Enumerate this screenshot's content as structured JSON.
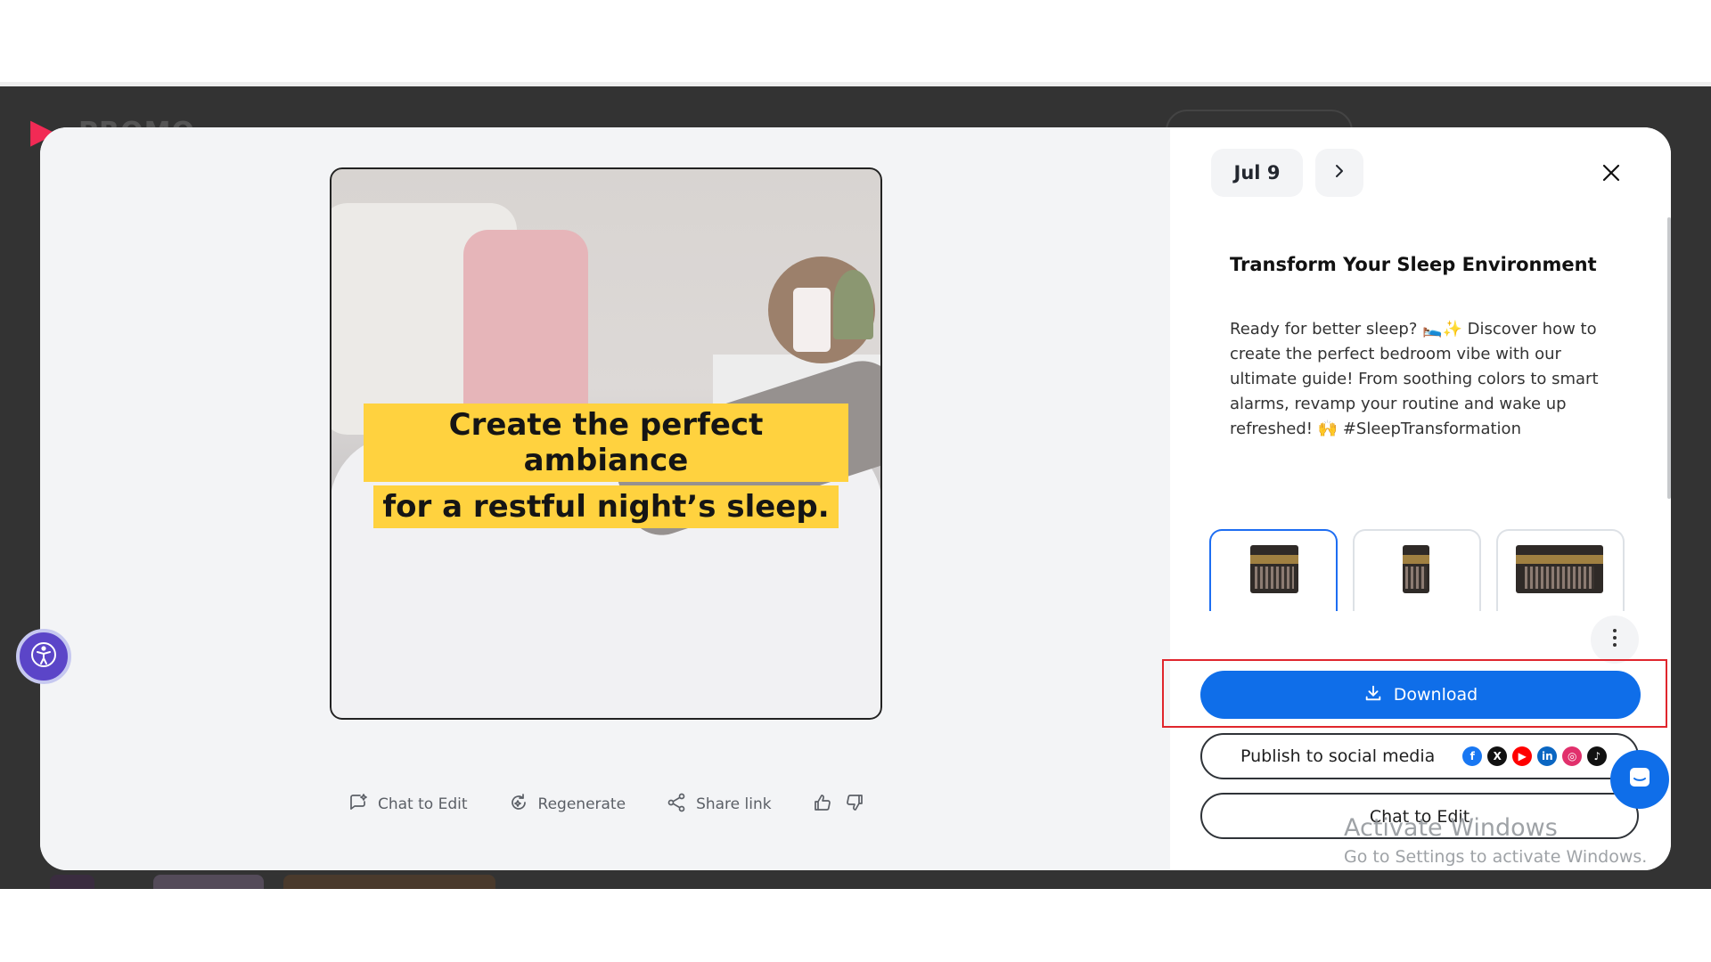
{
  "background": {
    "logo_text": "PROMO"
  },
  "preview": {
    "caption_line1": "Create the perfect ambiance",
    "caption_line2": "for a restful night’s sleep."
  },
  "actions": {
    "chat_to_edit": "Chat to Edit",
    "regenerate": "Regenerate",
    "share_link": "Share link"
  },
  "header": {
    "date": "Jul 9"
  },
  "post": {
    "title": "Transform Your Sleep Environment",
    "body": "Ready for better sleep? 🛌✨ Discover how to create the perfect bedroom vibe with our ultimate guide! From soothing colors to smart alarms, revamp your routine and wake up refreshed! 🙌 #SleepTransformation"
  },
  "buttons": {
    "download": "Download",
    "publish": "Publish to social media",
    "chat_to_edit": "Chat to Edit"
  },
  "social_icons": [
    "facebook-icon",
    "x-icon",
    "youtube-icon",
    "linkedin-icon",
    "instagram-icon",
    "tiktok-icon"
  ],
  "watermark": {
    "title": "Activate Windows",
    "subtitle": "Go to Settings to activate Windows."
  },
  "colors": {
    "accent": "#0f6ee9",
    "highlight_box": "#e0262d",
    "caption_bg": "#ffd23f",
    "overlay": "#333333"
  }
}
